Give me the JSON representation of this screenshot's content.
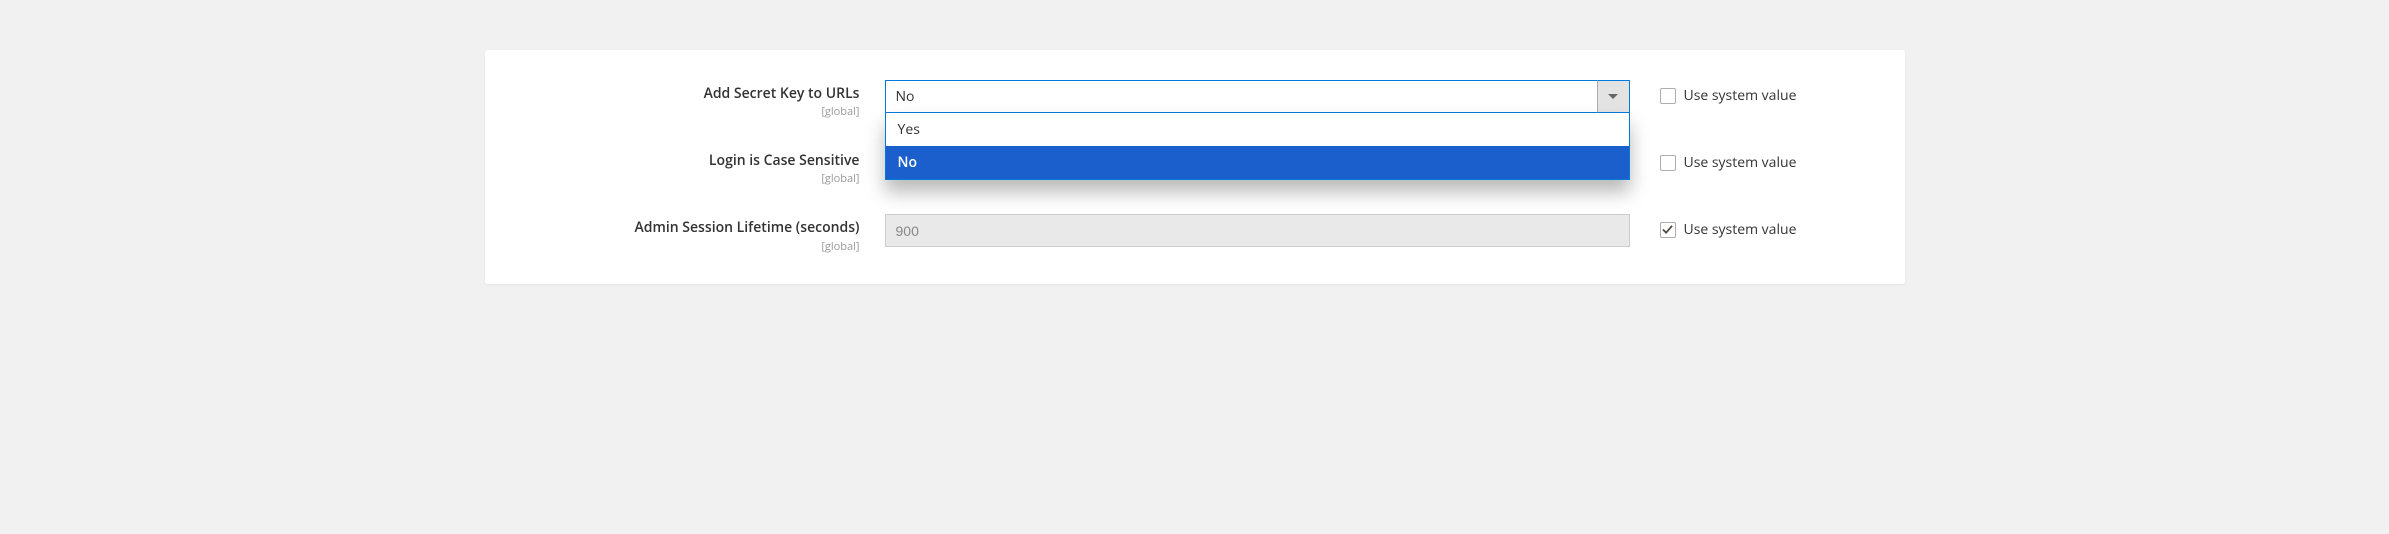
{
  "fields": [
    {
      "label": "Add Secret Key to URLs",
      "scope": "[global]",
      "type": "select",
      "value": "No",
      "options": [
        "Yes",
        "No"
      ],
      "open": true,
      "selectedOption": "No",
      "useSystemLabel": "Use system value",
      "useSystemChecked": false
    },
    {
      "label": "Login is Case Sensitive",
      "scope": "[global]",
      "type": "select-hidden",
      "value": "",
      "useSystemLabel": "Use system value",
      "useSystemChecked": false
    },
    {
      "label": "Admin Session Lifetime (seconds)",
      "scope": "[global]",
      "type": "text",
      "value": "900",
      "disabled": true,
      "useSystemLabel": "Use system value",
      "useSystemChecked": true
    }
  ]
}
